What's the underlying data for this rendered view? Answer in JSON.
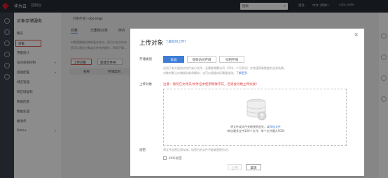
{
  "topbar": {
    "brand": "华为云",
    "console": "控制台",
    "search_placeholder": "搜索",
    "nav": [
      "更多",
      "中文 (简体)",
      "ccbi_oske"
    ]
  },
  "sidebar": {
    "title": "对象存储服务",
    "items": [
      {
        "label": "概览"
      },
      {
        "label": "对象"
      },
      {
        "label": "用量统计"
      },
      {
        "label": "访问权限控制"
      },
      {
        "label": "基础配置"
      },
      {
        "label": "域名管理"
      },
      {
        "label": "跨区域复制"
      },
      {
        "label": "数据回源"
      },
      {
        "label": "数据处理"
      },
      {
        "label": "桶清单"
      },
      {
        "label": "Data+"
      }
    ]
  },
  "page": {
    "breadcrumb_root": "对象存储",
    "breadcrumb_bucket": "obs-imgs",
    "tabs": [
      "对象",
      "已删除对象",
      "碎片"
    ],
    "desc1": "对象是数据存储的基本单位，您可以在文件夹…",
    "desc2": "您可以通过对象或文件夹的操作，例如下载…",
    "upload_button": "上传对象",
    "new_folder_button": "新建文件夹",
    "col_name": "名称",
    "col_class": "存储类别"
  },
  "modal": {
    "title": "上传对象",
    "title_link": "了解如何上传？",
    "storage_class_label": "存储类别",
    "storage_classes": [
      "标准",
      "低频访问存储",
      "归档存储"
    ],
    "selected_class_index": 0,
    "class_hint": "适用于有大量热点文件或小文件，且需要频繁访问（平均一个月多次）并快速获取数据的业务场景。",
    "class_hint2": "对象的默认存储类别继承桶的，也可以根据实际需要修改。",
    "class_hint_link": "了解更多",
    "upload_label": "上传对象",
    "warning": "注意：请勿在文件夹/文件名中使用特殊字符，否则会导致上传失败！",
    "drop_text": "将文件或文件夹拖拽到此处，或",
    "drop_link": "添加文件",
    "drop_limit": "（单次最多支持100个文件，单个文件最大5GB）",
    "encrypt_label": "加密",
    "encrypt_hint": "将文件加密后再存储，加密后的文件不能被直接访问。",
    "kms_label": "KMS加密",
    "upload_button": "上传",
    "cancel_button": "取消",
    "close": "×"
  }
}
